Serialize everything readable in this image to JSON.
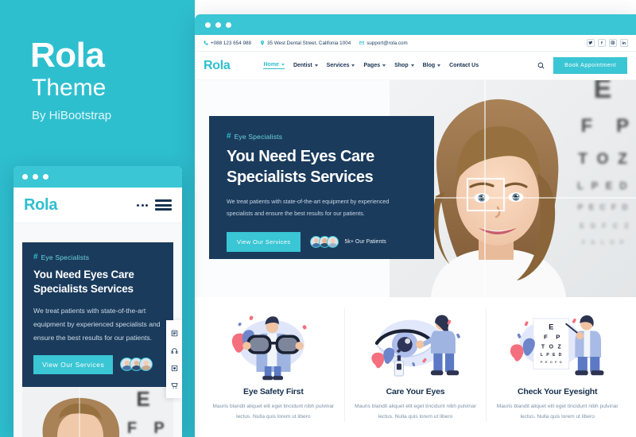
{
  "promo": {
    "title": "Rola",
    "subtitle": "Theme",
    "byline": "By HiBootstrap"
  },
  "colors": {
    "teal": "#2ebfcf",
    "teal_light": "#3ac6d4",
    "navy": "#1a3b5c",
    "heading": "#16314f",
    "body_text": "#7d92a8"
  },
  "desktop": {
    "titlebar": {
      "dots": 3
    },
    "topbar": {
      "phone": "+088 123 654 988",
      "address": "35 West Dental Street, Califonia 1004",
      "email": "support@rola.com",
      "social": [
        {
          "name": "twitter-icon",
          "label": "Twitter"
        },
        {
          "name": "facebook-icon",
          "label": "Facebook"
        },
        {
          "name": "instagram-icon",
          "label": "Instagram"
        },
        {
          "name": "linkedin-icon",
          "label": "LinkedIn"
        }
      ]
    },
    "nav": {
      "logo": "Rola",
      "items": [
        {
          "label": "Home",
          "has_caret": true,
          "active": true
        },
        {
          "label": "Dentist",
          "has_caret": true,
          "active": false
        },
        {
          "label": "Services",
          "has_caret": true,
          "active": false
        },
        {
          "label": "Pages",
          "has_caret": true,
          "active": false
        },
        {
          "label": "Shop",
          "has_caret": true,
          "active": false
        },
        {
          "label": "Blog",
          "has_caret": true,
          "active": false
        },
        {
          "label": "Contact Us",
          "has_caret": false,
          "active": false
        }
      ],
      "search_icon": "search-icon",
      "book_button": "Book Appointment"
    },
    "hero": {
      "tag_hash": "#",
      "tag": "Eye Specialists",
      "title": "You Need Eyes Care Specialists Services",
      "description": "We treat patients with state-of-the-art equipment by experienced specialists and ensure the best results for our patients.",
      "cta": "View Our Services",
      "patients_label": "5k+ Our Patients",
      "avatar_count": 3,
      "photo_alt": "Girl smiling in front of blurred eye chart with focus crosshair"
    },
    "tools": [
      {
        "name": "list-icon"
      },
      {
        "name": "headphones-icon"
      },
      {
        "name": "wishlist-icon"
      },
      {
        "name": "cart-icon"
      }
    ],
    "services": [
      {
        "art": "eyeglasses-illustration",
        "title": "Eye Safety First",
        "description": "Mauris blandit aliquet elit eget tincidunt nibh pulvinar lectus. Nulla quis lorem ut libero"
      },
      {
        "art": "eye-care-illustration",
        "title": "Care Your Eyes",
        "description": "Mauris blandit aliquet elit eget tincidunt nibh pulvinar lectus. Nulla quis lorem ut libero"
      },
      {
        "art": "eye-chart-illustration",
        "title": "Check Your Eyesight",
        "description": "Mauris blandit aliquet elit eget tincidunt nibh pulvinar lectus. Nulla quis lorem ut libero",
        "chart_letters": [
          "E",
          "F P",
          "T O Z",
          "L P E D",
          "P E O F D"
        ]
      }
    ]
  },
  "mobile": {
    "titlebar": {
      "dots": 3
    },
    "nav": {
      "logo": "Rola",
      "menu_icon": "hamburger-icon",
      "more_icon": "more-dots-icon"
    },
    "hero": {
      "tag_hash": "#",
      "tag": "Eye Specialists",
      "title": "You Need Eyes Care Specialists Services",
      "description": "We treat patients with state-of-the-art equipment by experienced specialists and ensure the best results for our patients.",
      "cta": "View Our Services",
      "avatar_count": 3
    },
    "tools": [
      {
        "name": "list-icon"
      },
      {
        "name": "headphones-icon"
      },
      {
        "name": "wishlist-icon"
      },
      {
        "name": "cart-icon"
      }
    ]
  }
}
